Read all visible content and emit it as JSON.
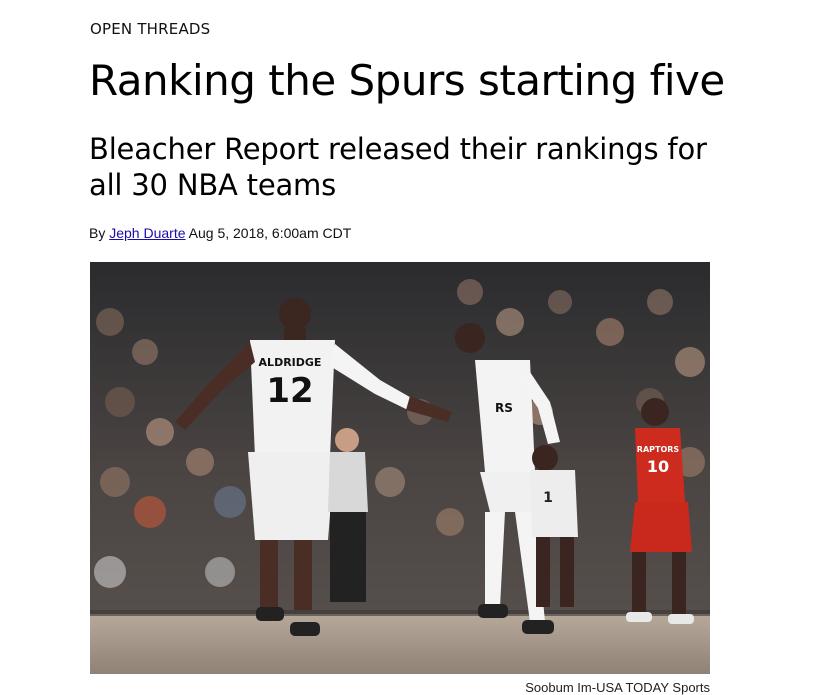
{
  "article": {
    "kicker": "OPEN THREADS",
    "title": "Ranking the Spurs starting five",
    "subtitle": "Bleacher Report released their rankings for all 30 NBA teams",
    "byline_prefix": "By",
    "author": "Jeph Duarte",
    "date": "Aug 5, 2018, 6:00am CDT"
  },
  "photo": {
    "credit": "Soobum Im-USA TODAY Sports",
    "jersey_left_name": "ALDRIDGE",
    "jersey_left_number": "12",
    "jersey_mid_text": "RS",
    "jersey_back_number": "1",
    "jersey_right_team": "RAPTORS",
    "jersey_right_number": "10"
  }
}
